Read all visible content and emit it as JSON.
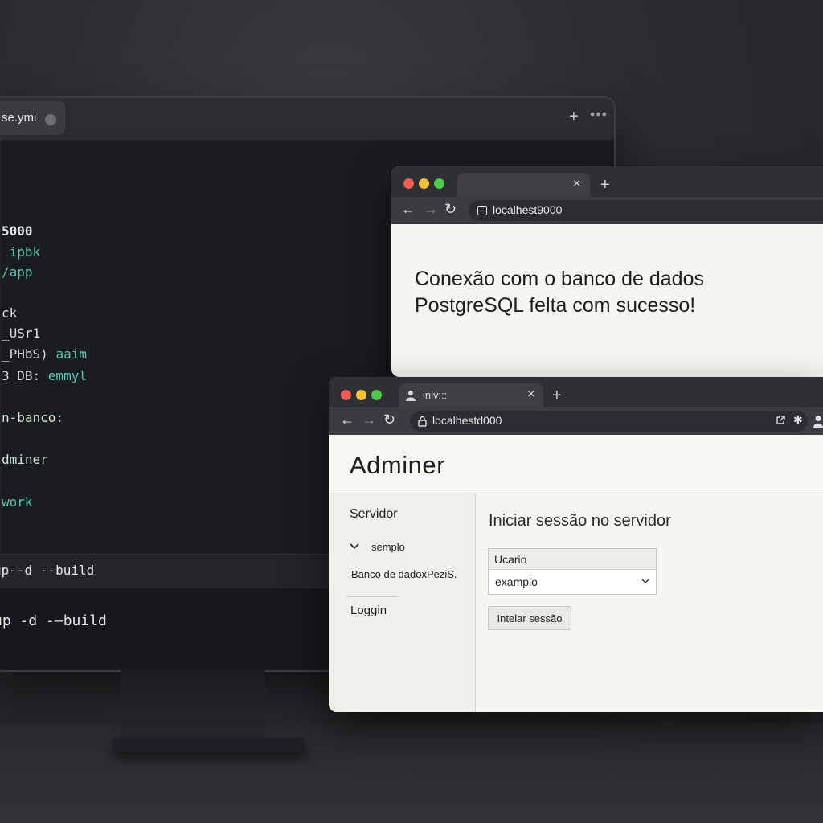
{
  "editor": {
    "tab_label": "se.ymi",
    "new_tab": "+",
    "more": "•••",
    "code_lines": [
      {
        "text": "5000",
        "color": "#dfe7f0",
        "bold": true
      },
      {
        "text": " ipbk",
        "color": "#56c8b6"
      },
      {
        "text": "/app",
        "color": "#56c8b6"
      },
      {
        "text": "ck",
        "color": "#dcdcdc"
      },
      {
        "text": "_USr1",
        "color": "#dcdcdc"
      },
      {
        "text": "_PHbS) aaim",
        "color": "#dcdcdc",
        "accent": "aaim",
        "accent_color": "#56c8b6"
      },
      {
        "text": "3_DB: emmyl",
        "color": "#dcdcdc",
        "accent": "emmyl",
        "accent_color": "#56c8b6"
      },
      {
        "text": "n-banco:",
        "color": "#cfe6d8"
      },
      {
        "text": "dminer",
        "color": "#cfe6d8"
      },
      {
        "text": "work",
        "color": "#56c8b6"
      }
    ],
    "terminal_bar": "up--d --build",
    "terminal": "up -d -–build"
  },
  "browser1": {
    "url": "localhest9000",
    "tab_close": "×",
    "new_tab": "+",
    "message": "Conexão com o banco de dados PostgreSQL felta com sucesso!"
  },
  "browser2": {
    "tab_label": "iniv:::",
    "tab_close": "×",
    "new_tab": "+",
    "url": "localhestd000",
    "header_title": "Adminer",
    "sidebar": {
      "heading": "Servidor",
      "server_item": "semplo",
      "database_item": "Banco de dadoxPeziS.",
      "login_link": "Loggin"
    },
    "main": {
      "title": "Iniciar sessão no servidor",
      "field_label": "Ucario",
      "field_value": "examplo",
      "submit_label": "Intelar sessão"
    }
  },
  "colors": {
    "accent_teal": "#56c8b6",
    "traffic_red": "#ee5c55",
    "traffic_yellow": "#f3bd3a",
    "traffic_green": "#4ec94a"
  },
  "icons": [
    "back-arrow-icon",
    "forward-arrow-icon",
    "reload-icon",
    "lock-icon",
    "share-icon",
    "extensions-icon",
    "profile-icon",
    "chevron-down-icon"
  ]
}
